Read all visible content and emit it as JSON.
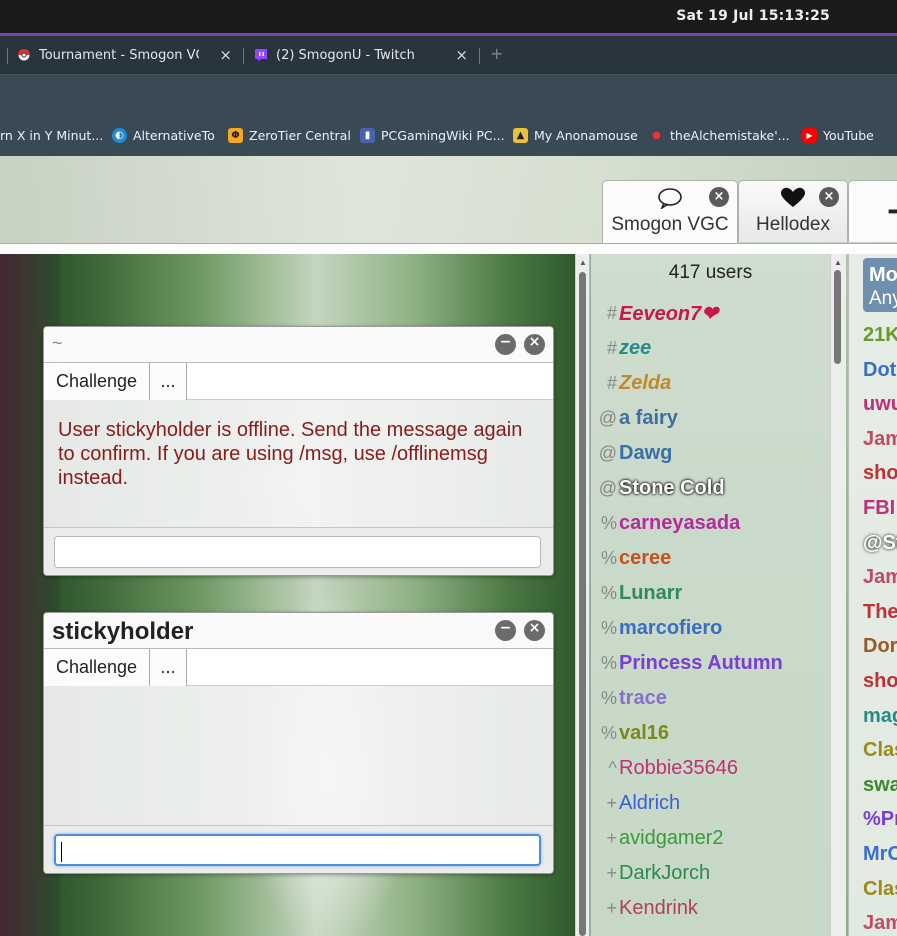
{
  "system": {
    "clock": "Sat 19 Jul  15:13:25"
  },
  "browser_tabs": [
    {
      "title": "Tournament - Smogon VGC L",
      "close": "×",
      "icon": "pokeball-icon"
    },
    {
      "title": "(2) SmogonU - Twitch",
      "close": "×",
      "icon": "twitch-icon"
    }
  ],
  "new_tab": "+",
  "bookmarks": [
    {
      "label": "rn X in Y Minut..."
    },
    {
      "label": "AlternativeTo"
    },
    {
      "label": "ZeroTier Central"
    },
    {
      "label": "PCGamingWiki PC..."
    },
    {
      "label": "My Anonamouse"
    },
    {
      "label": "theAlchemistake'..."
    },
    {
      "label": "YouTube"
    }
  ],
  "room_tabs": [
    {
      "label": "Smogon VGC",
      "icon": "speech-bubble-icon",
      "close": "×"
    },
    {
      "label": "Hellodex",
      "icon": "heart-icon",
      "close": "×"
    }
  ],
  "plus_tab": "+",
  "pm_windows": [
    {
      "title": "~",
      "buttons": [
        "Challenge",
        "..."
      ],
      "message": "User stickyholder is offline. Send the message again to confirm. If you are using /msg, use /offlinemsg instead.",
      "minimize": "−",
      "close": "×"
    },
    {
      "title": "stickyholder",
      "buttons": [
        "Challenge",
        "..."
      ],
      "message": "",
      "minimize": "−",
      "close": "×"
    }
  ],
  "userlist": {
    "count": "417 users",
    "users": [
      {
        "rank": "#",
        "name": "Eeveon7❤",
        "color": "#c9174a",
        "style": "bolditalic"
      },
      {
        "rank": "#",
        "name": "zee",
        "color": "#2a8a8a",
        "style": "bolditalic"
      },
      {
        "rank": "#",
        "name": "Zelda",
        "color": "#c0892a",
        "style": "bolditalic"
      },
      {
        "rank": "@",
        "name": "a fairy",
        "color": "#3f6fa0",
        "style": "bold"
      },
      {
        "rank": "@",
        "name": "Dawg",
        "color": "#3a6fa8",
        "style": "bold"
      },
      {
        "rank": "@",
        "name": "Stone Cold",
        "color": "#ffffff",
        "style": "boldglow"
      },
      {
        "rank": "%",
        "name": "carneyasada",
        "color": "#b52a9a",
        "style": "bold"
      },
      {
        "rank": "%",
        "name": "ceree",
        "color": "#c4521e",
        "style": "bold"
      },
      {
        "rank": "%",
        "name": "Lunarr",
        "color": "#2f8a5a",
        "style": "bold"
      },
      {
        "rank": "%",
        "name": "marcofiero",
        "color": "#3a6fc0",
        "style": "bold"
      },
      {
        "rank": "%",
        "name": "Princess Autumn",
        "color": "#7a3fd0",
        "style": "bold"
      },
      {
        "rank": "%",
        "name": "trace",
        "color": "#8a6fc8",
        "style": "bold"
      },
      {
        "rank": "%",
        "name": "val16",
        "color": "#7a8a1a",
        "style": "bold"
      },
      {
        "rank": "^",
        "name": "Robbie35646",
        "color": "#c0307a",
        "style": "normal"
      },
      {
        "rank": "+",
        "name": "Aldrich",
        "color": "#3a5fd0",
        "style": "normal"
      },
      {
        "rank": "+",
        "name": "avidgamer2",
        "color": "#3a9a3a",
        "style": "normal"
      },
      {
        "rank": "+",
        "name": "DarkJorch",
        "color": "#2a8a4a",
        "style": "normal"
      },
      {
        "rank": "+",
        "name": "Kendrink",
        "color": "#b0405a",
        "style": "normal"
      }
    ]
  },
  "chatlog": {
    "mod_box": {
      "line1": "Mo",
      "line2": "Any"
    },
    "lines": [
      {
        "text": "21K",
        "color": "#6a9a2a"
      },
      {
        "text": "Dot",
        "color": "#3a6fc0"
      },
      {
        "text": "uwu",
        "color": "#c0307a"
      },
      {
        "text": "Jam",
        "color": "#c04a6a"
      },
      {
        "text": "sho",
        "color": "#c0303a"
      },
      {
        "text": "FBI",
        "color": "#c0307a"
      },
      {
        "text": "@St",
        "color": "#ffffff"
      },
      {
        "text": "Jam",
        "color": "#c04a6a"
      },
      {
        "text": "The",
        "color": "#c0303a"
      },
      {
        "text": "Dor",
        "color": "#9a5a2a"
      },
      {
        "text": "sho",
        "color": "#c0303a"
      },
      {
        "text": "mag",
        "color": "#2a8a8a"
      },
      {
        "text": "Clas",
        "color": "#9a8a1a"
      },
      {
        "text": "swa",
        "color": "#3a8a2a"
      },
      {
        "text": "%Pr",
        "color": "#7a3fd0"
      },
      {
        "text": "MrC",
        "color": "#3a6fd0"
      },
      {
        "text": "Clas",
        "color": "#9a8a1a"
      },
      {
        "text": "Jam",
        "color": "#c04a6a"
      }
    ]
  }
}
